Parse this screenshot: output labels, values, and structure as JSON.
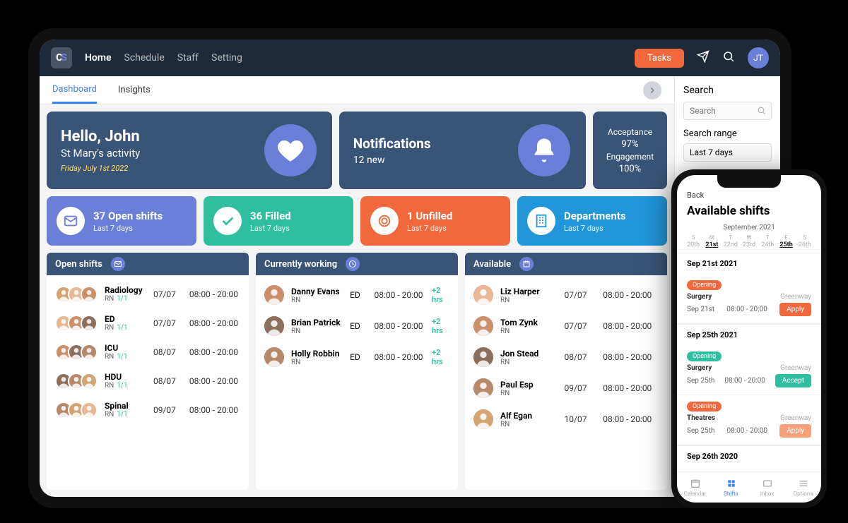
{
  "topbar": {
    "nav": [
      "Home",
      "Schedule",
      "Staff",
      "Setting"
    ],
    "tasks_label": "Tasks",
    "avatar": "JT"
  },
  "subnav": {
    "tabs": [
      "Dashboard",
      "Insights"
    ]
  },
  "hello": {
    "title": "Hello, John",
    "subtitle": "St Mary's activity",
    "date": "Friday July 1st 2022"
  },
  "notif": {
    "title": "Notifications",
    "sub": "12 new"
  },
  "metrics": {
    "accept_label": "Acceptance",
    "accept_val": "97%",
    "eng_label": "Engagement",
    "eng_val": "100%"
  },
  "stats": {
    "open": {
      "title": "37 Open shifts",
      "sub": "Last 7 days"
    },
    "filled": {
      "title": "36 Filled",
      "sub": "Last 7 days"
    },
    "unfilled": {
      "title": "1 Unfilled",
      "sub": "Last 7 days"
    },
    "dept": {
      "title": "Departments",
      "sub": "Last 7 days"
    }
  },
  "panels": {
    "open": {
      "title": "Open shifts",
      "rows": [
        {
          "dept": "Radiology",
          "role": "RN",
          "ratio": "1/1",
          "date": "07/07",
          "time": "08:00 - 20:00"
        },
        {
          "dept": "ED",
          "role": "RN",
          "ratio": "1/1",
          "date": "07/07",
          "time": "08:00 - 20:00"
        },
        {
          "dept": "ICU",
          "role": "RN",
          "ratio": "1/1",
          "date": "08/07",
          "time": "08:00 - 20:00"
        },
        {
          "dept": "HDU",
          "role": "RN",
          "ratio": "1/1",
          "date": "08/07",
          "time": "08:00 - 20:00"
        },
        {
          "dept": "Spinal",
          "role": "RN",
          "ratio": "1/1",
          "date": "09/07",
          "time": "08:00 - 20:00"
        }
      ]
    },
    "working": {
      "title": "Currently working",
      "rows": [
        {
          "name": "Danny Evans",
          "role": "RN",
          "dept": "ED",
          "time": "08:00 - 20:00",
          "extra": "+2 hrs"
        },
        {
          "name": "Brian Patrick",
          "role": "RN",
          "dept": "ED",
          "time": "08:00 - 20:00",
          "extra": "+2 hrs"
        },
        {
          "name": "Holly Robbin",
          "role": "RN",
          "dept": "ED",
          "time": "08:00 - 20:00",
          "extra": "+2 hrs"
        }
      ]
    },
    "available": {
      "title": "Available",
      "rows": [
        {
          "name": "Liz Harper",
          "role": "RN",
          "date": "07/07",
          "time": "08:00 - 20:00"
        },
        {
          "name": "Tom Zynk",
          "role": "RN",
          "date": "07/07",
          "time": "08:00 - 20:00"
        },
        {
          "name": "Jon Stead",
          "role": "RN",
          "date": "08/07",
          "time": "08:00 - 20:00"
        },
        {
          "name": "Paul Esp",
          "role": "RN",
          "date": "09/07",
          "time": "08:00 - 20:00"
        },
        {
          "name": "Alf Egan",
          "role": "RN",
          "date": "10/07",
          "time": "08:00 - 20:00"
        }
      ]
    }
  },
  "side": {
    "search_label": "Search",
    "search_ph": "Search",
    "range_label": "Search range",
    "range_val": "Last 7 days"
  },
  "phone": {
    "back": "Back",
    "title": "Available shifts",
    "month": "September 2021",
    "days": [
      {
        "d": "S",
        "n": "20th"
      },
      {
        "d": "M",
        "n": "21st",
        "sel": true
      },
      {
        "d": "T",
        "n": "22nd"
      },
      {
        "d": "W",
        "n": "23rd"
      },
      {
        "d": "T",
        "n": "24th"
      },
      {
        "d": "F",
        "n": "25th",
        "sel": true
      },
      {
        "d": "S",
        "n": "26th"
      }
    ],
    "groups": [
      {
        "head": "Sep 21st 2021",
        "cards": [
          {
            "tag": "Opening",
            "tagc": "orange",
            "title": "Surgery",
            "loc": "Greenway",
            "date": "Sep 21st",
            "time": "08:00 - 20:00",
            "btn": "Apply",
            "btnc": "papply"
          }
        ]
      },
      {
        "head": "Sep 25th 2021",
        "cards": [
          {
            "tag": "Opening",
            "tagc": "teal",
            "title": "Surgery",
            "loc": "Greenway",
            "date": "Sep 25th",
            "time": "08:00 - 20:00",
            "btn": "Accept",
            "btnc": "paccept"
          },
          {
            "tag": "Opening",
            "tagc": "orange",
            "title": "Theatres",
            "loc": "Greenway",
            "date": "Sep 25th",
            "time": "08:00 - 20:00",
            "btn": "Apply",
            "btnc": "papply lite"
          }
        ]
      },
      {
        "head": "Sep 26th 2020",
        "cards": []
      }
    ],
    "tabs": [
      "Calendar",
      "Shifts",
      "Inbox",
      "Options"
    ]
  }
}
